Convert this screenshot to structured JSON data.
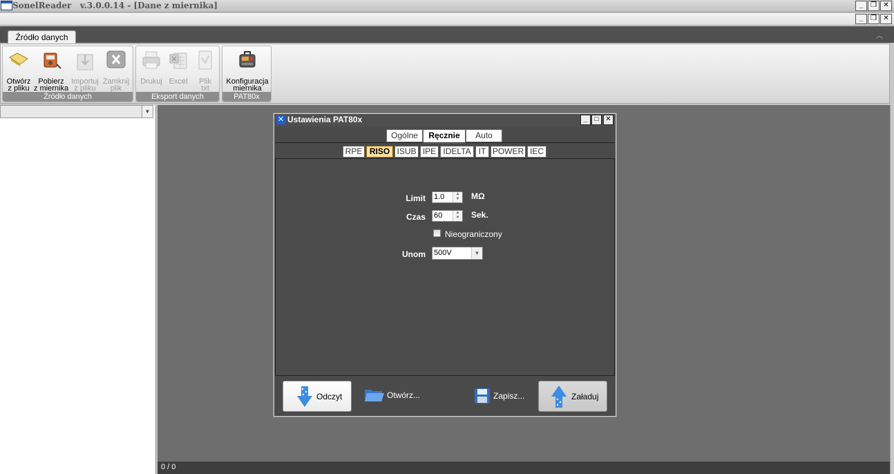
{
  "window": {
    "title": "SonelReader   v.3.0.0.14 - [Dane z miernika]",
    "minimize": "_",
    "restore": "▫",
    "close": "✕"
  },
  "ribbon": {
    "tab": "Źródło danych",
    "collapse_icon": "chevron-up-icon",
    "groups": [
      {
        "caption": "Źródło danych",
        "buttons": [
          {
            "label": "Otwórz\nz pliku",
            "icon": "folder-open-icon",
            "enabled": true
          },
          {
            "label": "Pobierz\nz miernika",
            "icon": "meter-download-icon",
            "enabled": true
          },
          {
            "label": "Importuj\nz pliku",
            "icon": "import-arrow-icon",
            "enabled": false
          },
          {
            "label": "Zamknij\nplik",
            "icon": "close-file-icon",
            "enabled": false
          }
        ]
      },
      {
        "caption": "Eksport danych",
        "buttons": [
          {
            "label": "Drukuj",
            "icon": "printer-icon",
            "enabled": false
          },
          {
            "label": "Excel",
            "icon": "excel-icon",
            "enabled": false
          },
          {
            "label": "Plik\ntxt",
            "icon": "text-file-icon",
            "enabled": false
          }
        ]
      },
      {
        "caption": "PAT80x",
        "buttons": [
          {
            "label": "Konfiguracja\nmiernika",
            "icon": "meter-config-icon",
            "enabled": true
          }
        ]
      }
    ]
  },
  "left_panel": {
    "combo_value": "",
    "combo_arrow": "▼"
  },
  "status": {
    "text": "0 / 0"
  },
  "dialog": {
    "title": "Ustawienia PAT80x",
    "controls": {
      "minimize": "_",
      "maximize": "□",
      "close": "✕"
    },
    "main_tabs": [
      "Ogólne",
      "Ręcznie",
      "Auto"
    ],
    "active_main_tab": "Ręcznie",
    "sub_tabs": [
      "RPE",
      "RISO",
      "ISUB",
      "IPE",
      "IDELTA",
      "IT",
      "POWER",
      "IEC"
    ],
    "active_sub_tab": "RISO",
    "fields": {
      "limit_label": "Limit",
      "limit_value": "1.0",
      "limit_unit": "MΩ",
      "czas_label": "Czas",
      "czas_value": "60",
      "czas_unit": "Sek.",
      "unlimited_label": "Nieograniczony",
      "unlimited_checked": false,
      "unom_label": "Unom",
      "unom_value": "500V"
    },
    "buttons": {
      "read": "Odczyt",
      "open": "Otwórz...",
      "save": "Zapisz...",
      "load": "Załaduj"
    }
  }
}
